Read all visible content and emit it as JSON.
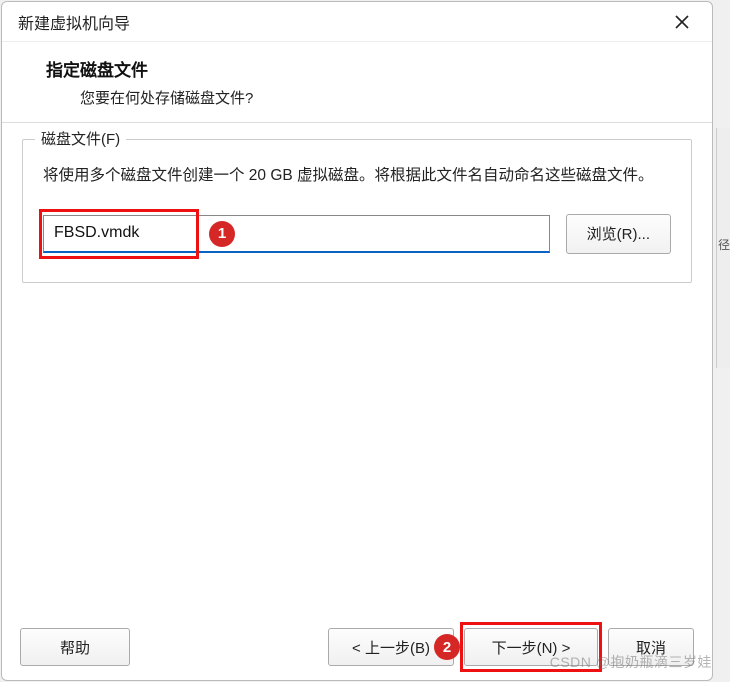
{
  "window": {
    "title": "新建虚拟机向导"
  },
  "header": {
    "title": "指定磁盘文件",
    "subtitle": "您要在何处存储磁盘文件?"
  },
  "group": {
    "legend": "磁盘文件(F)",
    "description": "将使用多个磁盘文件创建一个 20 GB 虚拟磁盘。将根据此文件名自动命名这些磁盘文件。"
  },
  "form": {
    "file_value": "FBSD.vmdk",
    "browse_label": "浏览(R)..."
  },
  "annotations": {
    "badge1": "1",
    "badge2": "2"
  },
  "footer": {
    "help": "帮助",
    "back": "< 上一步(B)",
    "next": "下一步(N) >",
    "cancel": "取消"
  },
  "watermark": "CSDN @抱奶瓶滴三岁娃",
  "side_char": "径"
}
